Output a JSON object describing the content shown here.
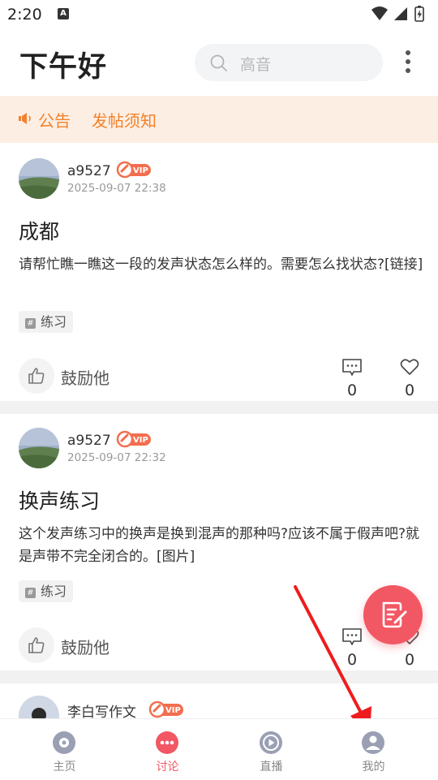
{
  "status_bar": {
    "time": "2:20",
    "notification_icon": "A"
  },
  "header": {
    "greeting": "下午好",
    "search_placeholder": "高音"
  },
  "notice": {
    "announcement": "公告",
    "posting_rules": "发帖须知"
  },
  "posts": [
    {
      "username": "a9527",
      "vip": "VIP",
      "time": "2025-09-07 22:38",
      "title": "成都",
      "body": "请帮忙瞧一瞧这一段的发声状态怎么样的。需要怎么找状态?[链接]",
      "tag": "练习",
      "encourage": "鼓励他",
      "comments": "0",
      "likes": "0"
    },
    {
      "username": "a9527",
      "vip": "VIP",
      "time": "2025-09-07 22:32",
      "title": "换声练习",
      "body": "这个发声练习中的换声是换到混声的那种吗?应该不属于假声吧?就是声带不完全闭合的。[图片]",
      "tag": "练习",
      "encourage": "鼓励他",
      "comments": "0",
      "likes": "0"
    },
    {
      "username": "李白写作文",
      "vip": "VIP"
    }
  ],
  "bottom_nav": [
    {
      "label": "主页",
      "icon": "home-disc-icon",
      "active": false
    },
    {
      "label": "讨论",
      "icon": "chat-dots-icon",
      "active": true
    },
    {
      "label": "直播",
      "icon": "play-circle-icon",
      "active": false
    },
    {
      "label": "我的",
      "icon": "profile-icon",
      "active": false
    }
  ],
  "colors": {
    "accent": "#f25764",
    "notice_bg": "#fdeee3",
    "notice_text": "#f2822c",
    "vip": "#f26e4f"
  }
}
